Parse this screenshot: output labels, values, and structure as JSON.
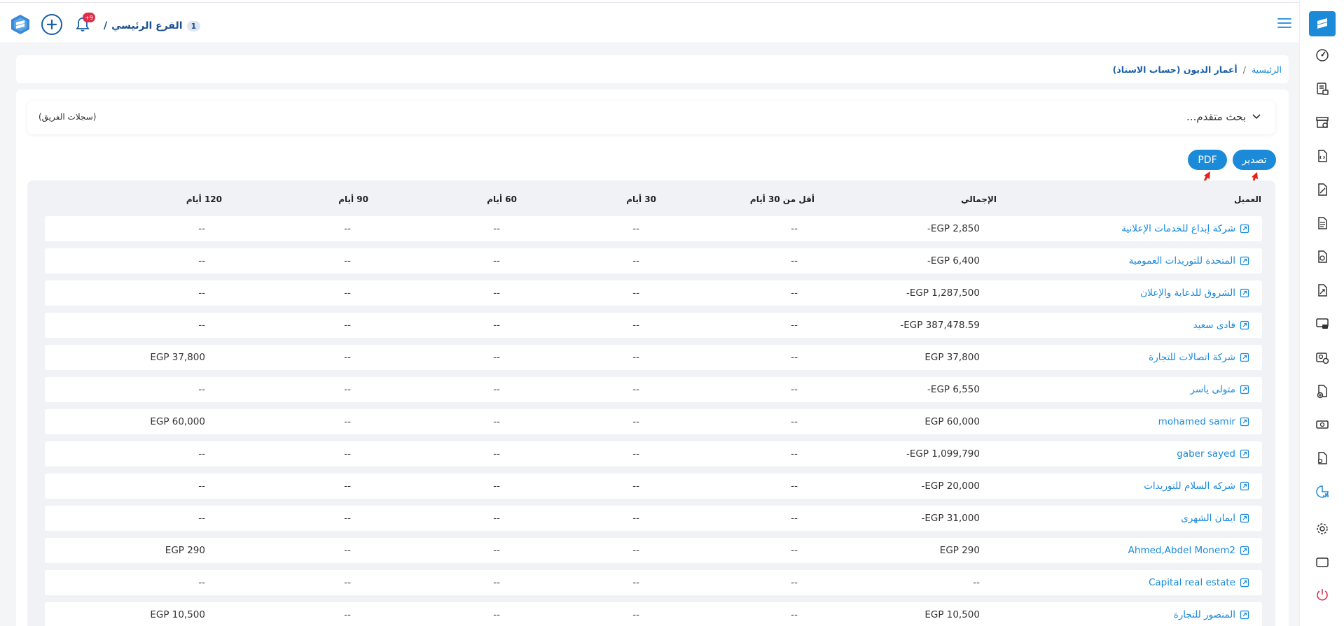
{
  "header": {
    "branch_name": "الفرع الرئيسي",
    "branch_suffix": "/",
    "branch_number": "1",
    "notification_count": "+9"
  },
  "breadcrumb": {
    "home": "الرئيسية",
    "separator": "/",
    "current": "أعمار الديون (حساب الاستاذ)"
  },
  "search": {
    "label": "بحث متقدم...",
    "team_records": "(سجلات الفريق)"
  },
  "actions": {
    "export_label": "تصدير",
    "pdf_label": "PDF"
  },
  "colors": {
    "accent": "#1a8ad9",
    "brand_dark": "#1a5fa8",
    "badge": "#e02c4b",
    "arrow": "#e8201a",
    "logout": "#e02c4b"
  },
  "table": {
    "headers": {
      "client": "العميل",
      "total": "الإجمالي",
      "lt30": "أقل من 30 أيام",
      "d30": "30 أيام",
      "d60": "60 أيام",
      "d90": "90 أيام",
      "d120": "120 أيام"
    },
    "rows": [
      {
        "client": "شركة إبداع للخدمات الإعلانية",
        "total": "-EGP 2,850",
        "lt30": "--",
        "d30": "--",
        "d60": "--",
        "d90": "--",
        "d120": "--"
      },
      {
        "client": "المتحدة للتوريدات العمومية",
        "total": "-EGP 6,400",
        "lt30": "--",
        "d30": "--",
        "d60": "--",
        "d90": "--",
        "d120": "--"
      },
      {
        "client": "الشروق للدعاية والإعلان",
        "total": "-EGP 1,287,500",
        "lt30": "--",
        "d30": "--",
        "d60": "--",
        "d90": "--",
        "d120": "--"
      },
      {
        "client": "فادى سعيد",
        "total": "-EGP 387,478.59",
        "lt30": "--",
        "d30": "--",
        "d60": "--",
        "d90": "--",
        "d120": "--"
      },
      {
        "client": "شركة اتصالات للتجارة",
        "total": "EGP 37,800",
        "lt30": "--",
        "d30": "--",
        "d60": "--",
        "d90": "--",
        "d120": "EGP 37,800"
      },
      {
        "client": "متولى ياسر",
        "total": "-EGP 6,550",
        "lt30": "--",
        "d30": "--",
        "d60": "--",
        "d90": "--",
        "d120": "--"
      },
      {
        "client": "mohamed samir",
        "total": "EGP 60,000",
        "lt30": "--",
        "d30": "--",
        "d60": "--",
        "d90": "--",
        "d120": "EGP 60,000"
      },
      {
        "client": "gaber sayed",
        "total": "-EGP 1,099,790",
        "lt30": "--",
        "d30": "--",
        "d60": "--",
        "d90": "--",
        "d120": "--"
      },
      {
        "client": "شركه السلام للتوريدات",
        "total": "-EGP 20,000",
        "lt30": "--",
        "d30": "--",
        "d60": "--",
        "d90": "--",
        "d120": "--"
      },
      {
        "client": "ايمان الشهرى",
        "total": "-EGP 31,000",
        "lt30": "--",
        "d30": "--",
        "d60": "--",
        "d90": "--",
        "d120": "--"
      },
      {
        "client": "Ahmed,Abdel Monem2",
        "total": "EGP 290",
        "lt30": "--",
        "d30": "--",
        "d60": "--",
        "d90": "--",
        "d120": "EGP 290"
      },
      {
        "client": "Capital real estate",
        "total": "--",
        "lt30": "--",
        "d30": "--",
        "d60": "--",
        "d90": "--",
        "d120": "--"
      },
      {
        "client": "المنصور للتجارة",
        "total": "EGP 10,500",
        "lt30": "--",
        "d30": "--",
        "d60": "--",
        "d90": "--",
        "d120": "EGP 10,500"
      }
    ]
  },
  "sidebar": {
    "items": [
      {
        "icon": "dashboard-icon"
      },
      {
        "icon": "sales-icon"
      },
      {
        "icon": "inventory-icon"
      },
      {
        "icon": "invoice-icon"
      },
      {
        "icon": "purchase-icon"
      },
      {
        "icon": "document-icon"
      },
      {
        "icon": "accounting-icon"
      },
      {
        "icon": "finance-icon"
      },
      {
        "icon": "pos-icon"
      },
      {
        "icon": "employees-icon"
      },
      {
        "icon": "payroll-icon"
      },
      {
        "icon": "cash-icon"
      },
      {
        "icon": "contracts-icon"
      },
      {
        "icon": "reports-icon"
      },
      {
        "icon": "settings-icon"
      },
      {
        "icon": "screen-icon"
      },
      {
        "icon": "logout-icon"
      }
    ]
  }
}
